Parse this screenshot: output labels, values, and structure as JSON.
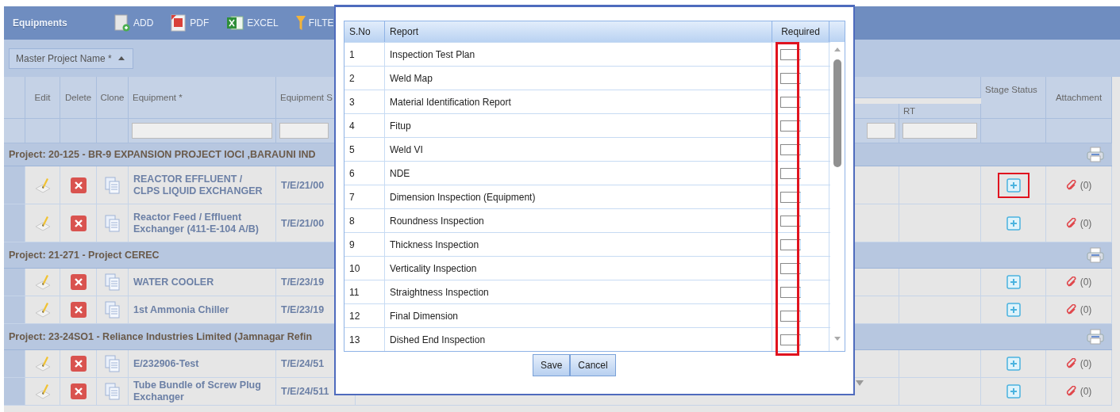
{
  "toolbar": {
    "title": "Equipments",
    "actions": [
      {
        "kind": "add",
        "label": "ADD"
      },
      {
        "kind": "pdf",
        "label": "PDF"
      },
      {
        "kind": "excel",
        "label": "EXCEL"
      },
      {
        "kind": "filter",
        "label": "FILTE"
      }
    ]
  },
  "group_by": {
    "label": "Master Project Name *",
    "sort_ascending": true
  },
  "columns": {
    "edit": "Edit",
    "delete": "Delete",
    "clone": "Clone",
    "equipment": "Equipment *",
    "equipment_s": "Equipment S",
    "rt": "RT",
    "stage_status": "Stage Status",
    "attachment": "Attachment"
  },
  "groups": [
    {
      "label": "Project:  20-125 - BR-9 EXPANSION PROJECT IOCl ,BARAUNI IND",
      "rows": [
        {
          "equipment": "REACTOR EFFLUENT / CLPS LIQUID EXCHANGER",
          "equipment_s": "T/E/21/00",
          "attachment": "(0)",
          "highlighted": true
        },
        {
          "equipment": "Reactor Feed / Effluent Exchanger (411-E-104 A/B)",
          "equipment_s": "T/E/21/00",
          "attachment": "(0)",
          "highlighted": false
        }
      ]
    },
    {
      "label": "Project:  21-271 - Project CEREC",
      "rows": [
        {
          "equipment": "WATER COOLER",
          "equipment_s": "T/E/23/19",
          "attachment": "(0)",
          "highlighted": false
        },
        {
          "equipment": "1st Ammonia Chiller",
          "equipment_s": "T/E/23/19",
          "attachment": "(0)",
          "highlighted": false
        }
      ]
    },
    {
      "label": "Project:  23-24SO1 - Reliance Industries Limited (Jamnagar Refin",
      "rows": [
        {
          "equipment": "E/232906-Test",
          "equipment_s": "T/E/24/51",
          "attachment": "(0)",
          "highlighted": false
        },
        {
          "equipment": "Tube Bundle of Screw Plug Exchanger",
          "equipment_s": "T/E/24/511",
          "attachment": "(0)",
          "highlighted": false
        }
      ]
    }
  ],
  "modal": {
    "columns": [
      "S.No",
      "Report",
      "Required"
    ],
    "required_highlighted": true,
    "rows": [
      {
        "sno": "1",
        "report": "Inspection Test Plan",
        "required": false
      },
      {
        "sno": "2",
        "report": "Weld Map",
        "required": false
      },
      {
        "sno": "3",
        "report": "Material Identification Report",
        "required": false
      },
      {
        "sno": "4",
        "report": "Fitup",
        "required": false
      },
      {
        "sno": "5",
        "report": "Weld VI",
        "required": false
      },
      {
        "sno": "6",
        "report": "NDE",
        "required": false
      },
      {
        "sno": "7",
        "report": "Dimension Inspection (Equipment)",
        "required": false
      },
      {
        "sno": "8",
        "report": "Roundness Inspection",
        "required": false
      },
      {
        "sno": "9",
        "report": "Thickness Inspection",
        "required": false
      },
      {
        "sno": "10",
        "report": "Verticality Inspection",
        "required": false
      },
      {
        "sno": "11",
        "report": "Straightness Inspection",
        "required": false
      },
      {
        "sno": "12",
        "report": "Final Dimension",
        "required": false
      },
      {
        "sno": "13",
        "report": "Dished End Inspection",
        "required": false
      }
    ],
    "buttons": [
      "Save",
      "Cancel"
    ]
  }
}
